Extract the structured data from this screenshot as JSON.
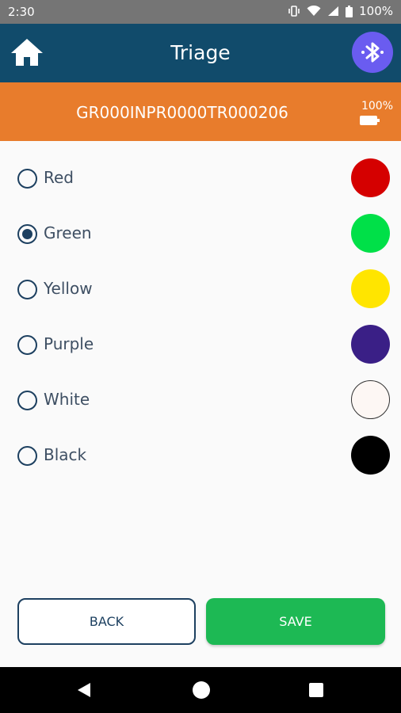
{
  "status_bar": {
    "time": "2:30",
    "battery": "100%",
    "icons": [
      "vibrate-icon",
      "wifi-icon",
      "signal-icon",
      "battery-icon"
    ]
  },
  "app_bar": {
    "title": "Triage",
    "home_icon": "home-icon",
    "bluetooth_icon": "bluetooth-icon",
    "color": "#114b6b"
  },
  "device": {
    "id": "GR000INPR0000TR000206",
    "battery": "100%",
    "bar_color": "#e87c2c"
  },
  "options": [
    {
      "label": "Red",
      "color": "#d50000",
      "checked": false
    },
    {
      "label": "Green",
      "color": "#00e048",
      "checked": true
    },
    {
      "label": "Yellow",
      "color": "#ffe500",
      "checked": false
    },
    {
      "label": "Purple",
      "color": "#3a1f86",
      "checked": false
    },
    {
      "label": "White",
      "color": "#fdf7f4",
      "checked": false
    },
    {
      "label": "Black",
      "color": "#000000",
      "checked": false
    }
  ],
  "buttons": {
    "back": "BACK",
    "save": "SAVE",
    "save_color": "#1db954"
  }
}
